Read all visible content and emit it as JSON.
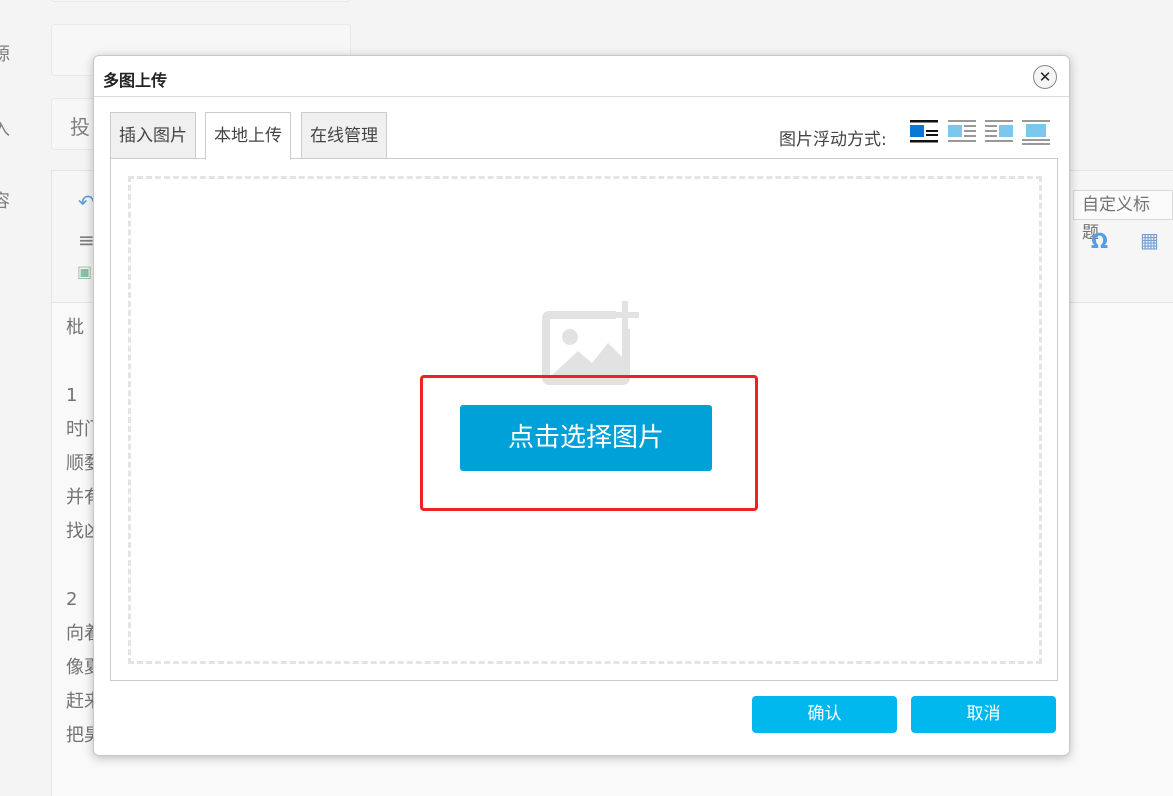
{
  "background": {
    "side_labels": [
      "源",
      "入",
      "容"
    ],
    "input_partial_text": "投",
    "editor_lines": [
      "枇",
      "",
      "1",
      "时门",
      "顺婺",
      "并有",
      "找凶",
      "",
      "2",
      "向着",
      "像夏",
      "赶来",
      "把昊"
    ],
    "custom_title_label": "自定义标题",
    "icons": [
      "undo-icon",
      "align-icon",
      "image-icon",
      "omega-icon",
      "table-icon"
    ]
  },
  "dialog": {
    "title": "多图上传",
    "close_icon": "close-circle-icon",
    "tabs": [
      {
        "label": "插入图片",
        "active": false
      },
      {
        "label": "本地上传",
        "active": true
      },
      {
        "label": "在线管理",
        "active": false
      }
    ],
    "float_label": "图片浮动方式:",
    "float_options": [
      "float-none-icon",
      "float-left-icon",
      "float-right-icon",
      "float-center-icon"
    ],
    "upload": {
      "placeholder_icon": "image-add-icon",
      "select_button": "点击选择图片"
    },
    "confirm_button": "确认",
    "cancel_button": "取消"
  },
  "colors": {
    "primary_button": "#00a0d8",
    "footer_button": "#00b7ee",
    "highlight": "#ee2222",
    "float_active": "#0a78d6"
  }
}
